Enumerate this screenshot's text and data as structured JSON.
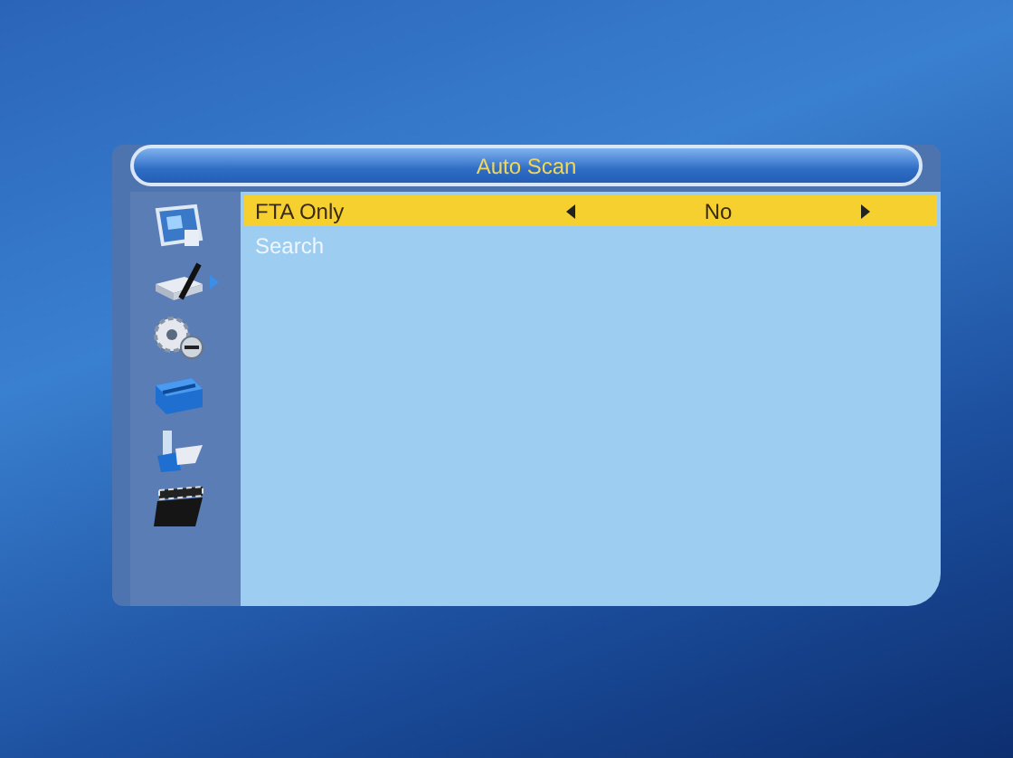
{
  "window": {
    "title": "Auto Scan"
  },
  "sidebar": {
    "items": [
      {
        "kind": "windows",
        "selected": false
      },
      {
        "kind": "dish",
        "selected": true
      },
      {
        "kind": "gears",
        "selected": false
      },
      {
        "kind": "toolbox",
        "selected": false
      },
      {
        "kind": "usb",
        "selected": false
      },
      {
        "kind": "clapper",
        "selected": false
      }
    ]
  },
  "menu": {
    "items": [
      {
        "label": "FTA Only",
        "value": "No",
        "selected": true
      },
      {
        "label": "Search",
        "selected": false
      }
    ]
  }
}
